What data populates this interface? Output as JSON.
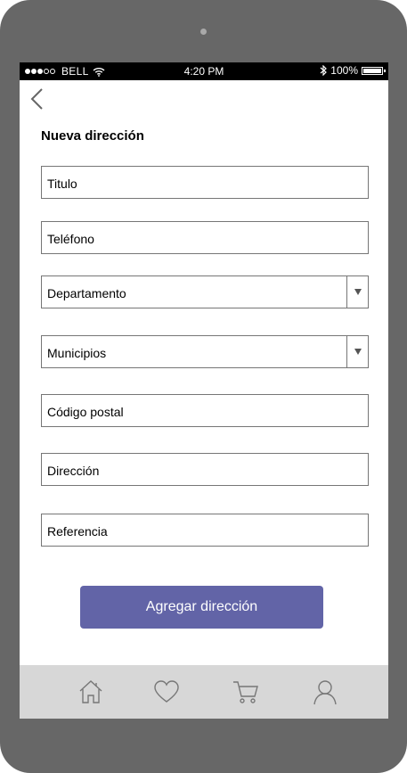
{
  "status_bar": {
    "carrier": "BELL",
    "time": "4:20 PM",
    "battery": "100%"
  },
  "page": {
    "title": "Nueva dirección"
  },
  "form": {
    "titulo_placeholder": "Titulo",
    "telefono_placeholder": "Teléfono",
    "departamento_label": "Departamento",
    "municipios_label": "Municipios",
    "codigo_postal_placeholder": "Código postal",
    "direccion_placeholder": "Dirección",
    "referencia_placeholder": "Referencia",
    "submit_label": "Agregar dirección"
  },
  "colors": {
    "accent": "#6264a7",
    "tabbar": "#d7d7d7",
    "device": "#676767"
  },
  "tabbar": {
    "icons": [
      "home-icon",
      "heart-icon",
      "cart-icon",
      "user-icon"
    ]
  }
}
